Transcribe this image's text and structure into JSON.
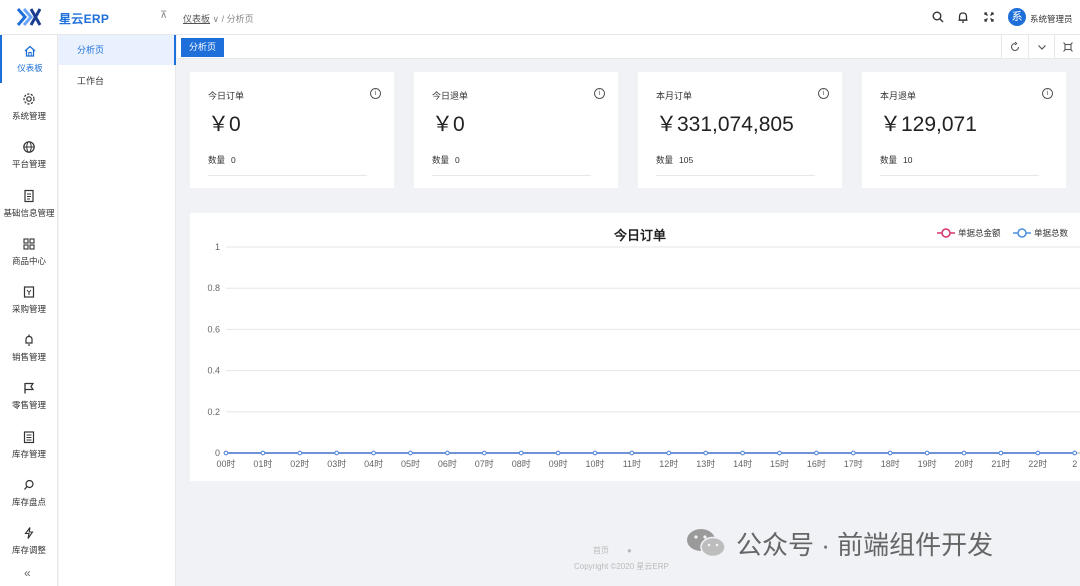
{
  "app": {
    "brand": "星云ERP",
    "username": "系统管理员",
    "avatar_text": "系"
  },
  "breadcrumb": {
    "first": "仪表板",
    "sep": "∨ /",
    "current": "分析页"
  },
  "rail": [
    {
      "label": "仪表板",
      "icon": "home-icon",
      "active": true
    },
    {
      "label": "系统管理",
      "icon": "gear-icon"
    },
    {
      "label": "平台管理",
      "icon": "globe-icon"
    },
    {
      "label": "基础信息管理",
      "icon": "document-icon"
    },
    {
      "label": "商品中心",
      "icon": "grid-icon"
    },
    {
      "label": "采购管理",
      "icon": "purchase-icon"
    },
    {
      "label": "销售管理",
      "icon": "bell-icon"
    },
    {
      "label": "零售管理",
      "icon": "flag-icon"
    },
    {
      "label": "库存管理",
      "icon": "clipboard-icon"
    },
    {
      "label": "库存盘点",
      "icon": "search-doc-icon"
    },
    {
      "label": "库存调整",
      "icon": "lightning-icon"
    }
  ],
  "rail_collapse": "«",
  "submenu": [
    {
      "label": "分析页",
      "active": true
    },
    {
      "label": "工作台"
    }
  ],
  "tabs": [
    {
      "label": "分析页"
    }
  ],
  "cards": [
    {
      "title": "今日订单",
      "value": "￥0",
      "count_label": "数量",
      "count": "0"
    },
    {
      "title": "今日退单",
      "value": "￥0",
      "count_label": "数量",
      "count": "0"
    },
    {
      "title": "本月订单",
      "value": "￥331,074,805",
      "count_label": "数量",
      "count": "105"
    },
    {
      "title": "本月退单",
      "value": "￥129,071",
      "count_label": "数量",
      "count": "10"
    }
  ],
  "card_info_glyph": "i",
  "chart_data": {
    "type": "line",
    "title": "今日订单",
    "categories": [
      "00时",
      "01时",
      "02时",
      "03时",
      "04时",
      "05时",
      "06时",
      "07时",
      "08时",
      "09时",
      "10时",
      "11时",
      "12时",
      "13时",
      "14时",
      "15时",
      "16时",
      "17时",
      "18时",
      "19时",
      "20时",
      "21时",
      "22时",
      "2"
    ],
    "series": [
      {
        "name": "单据总金额",
        "color": "#d6336c",
        "values": [
          0,
          0,
          0,
          0,
          0,
          0,
          0,
          0,
          0,
          0,
          0,
          0,
          0,
          0,
          0,
          0,
          0,
          0,
          0,
          0,
          0,
          0,
          0,
          0
        ]
      },
      {
        "name": "单据总数",
        "color": "#4a90e2",
        "values": [
          0,
          0,
          0,
          0,
          0,
          0,
          0,
          0,
          0,
          0,
          0,
          0,
          0,
          0,
          0,
          0,
          0,
          0,
          0,
          0,
          0,
          0,
          0,
          0
        ]
      }
    ],
    "ylim": [
      0,
      1
    ],
    "yticks": [
      "0",
      "0.2",
      "0.4",
      "0.6",
      "0.8",
      "1"
    ],
    "grid": true,
    "legend": "top-right"
  },
  "footer": {
    "link1": "首页",
    "copyright": "Copyright ©2020 星云ERP"
  },
  "watermark": "公众号 · 前端组件开发"
}
